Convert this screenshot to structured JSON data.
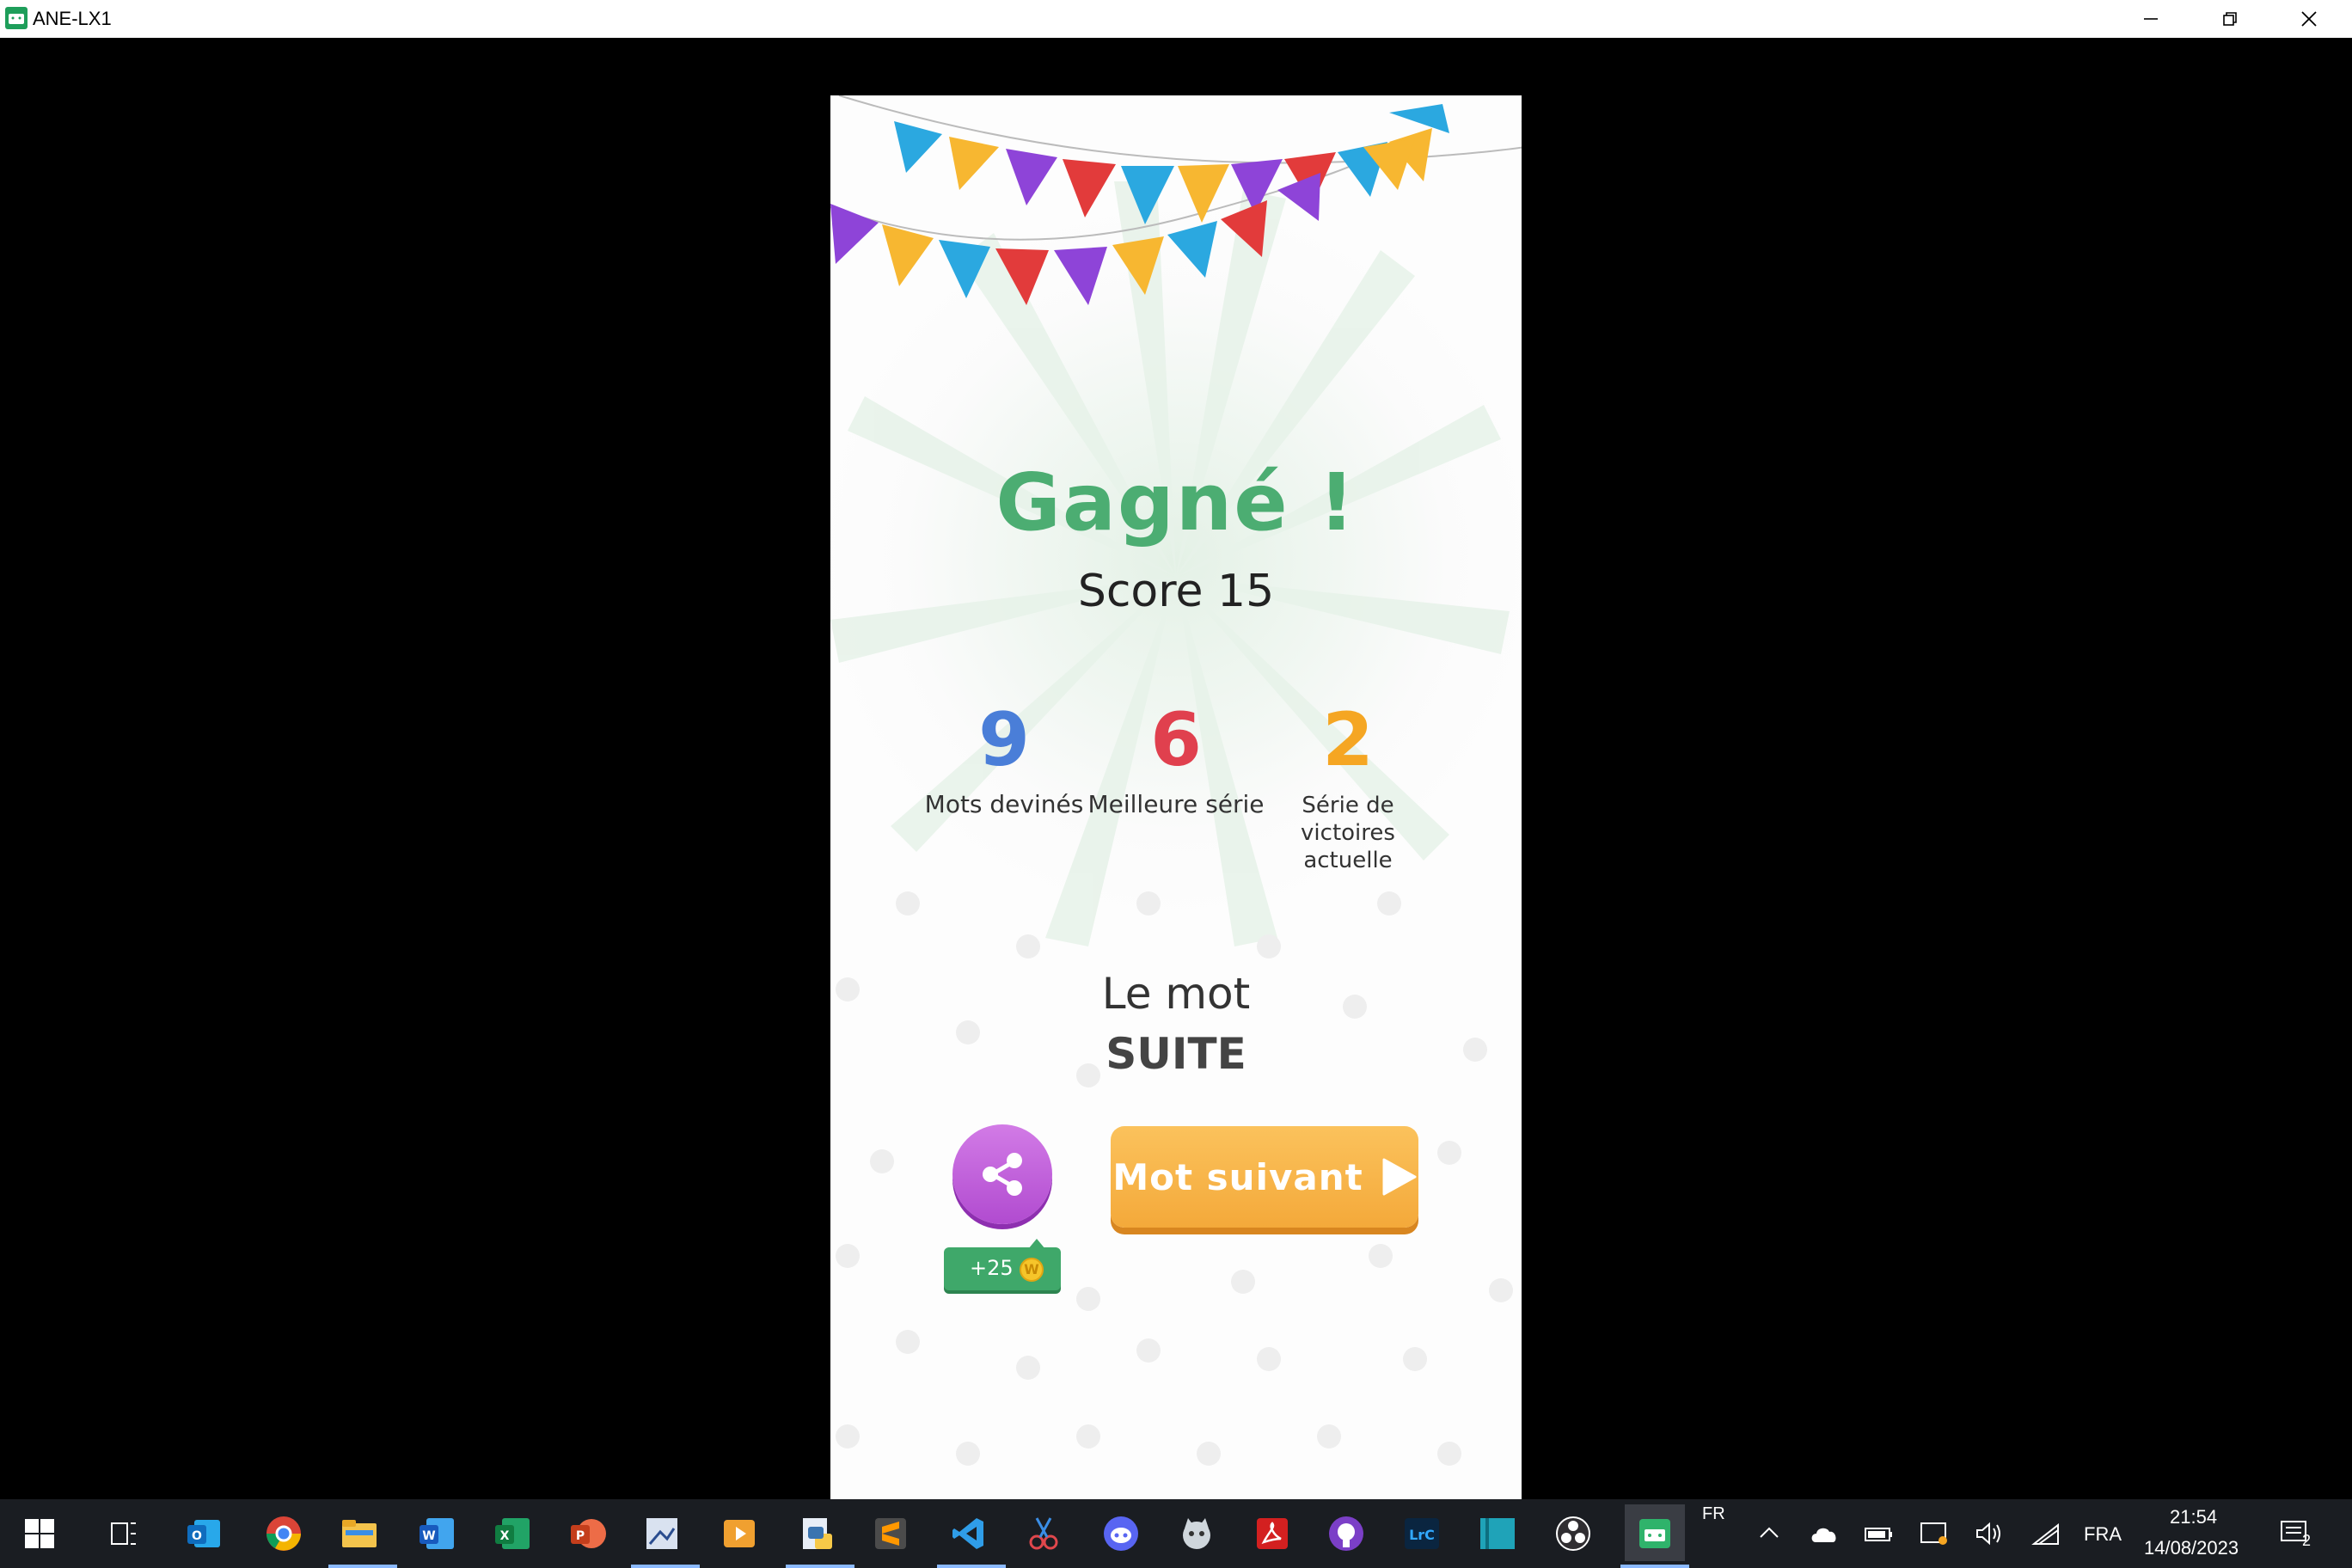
{
  "window": {
    "title": "ANE-LX1",
    "minimize_label": "Minimize",
    "restore_label": "Restore",
    "close_label": "Close"
  },
  "game": {
    "title": "Gagné !",
    "score_text": "Score 15",
    "stats": [
      {
        "value": "9",
        "label": "Mots devinés",
        "color": "#4a7ed8"
      },
      {
        "value": "6",
        "label": "Meilleure série",
        "color": "#e0404e"
      },
      {
        "value": "2",
        "label_line1": "Série de",
        "label_line2": "victoires actuelle",
        "color": "#f5a623"
      }
    ],
    "word_label": "Le mot",
    "word_value": "SUITE",
    "share_reward": "+25",
    "next_button": "Mot suivant",
    "colors": {
      "title": "#4cad72",
      "next_button": "#f4a93a",
      "share_button": "#b14bd0",
      "reward_badge": "#3fa86a"
    }
  },
  "taskbar": {
    "apps": [
      "start-icon",
      "task-view-icon",
      "outlook-icon",
      "chrome-icon",
      "file-explorer-icon",
      "word-icon",
      "excel-icon",
      "powerpoint-icon",
      "photo-editor-icon",
      "media-player-icon",
      "python-editor-icon",
      "sublime-text-icon",
      "vscode-icon",
      "snipping-tool-icon",
      "discord-icon",
      "cat-app-icon",
      "acrobat-icon",
      "github-icon",
      "lightroom-icon",
      "app-tile-icon",
      "obs-icon",
      "android-emulator-icon"
    ],
    "language_indicator": "FR",
    "input_lang": "FRA",
    "time": "21:54",
    "date": "14/08/2023",
    "notifications_count": "2"
  }
}
